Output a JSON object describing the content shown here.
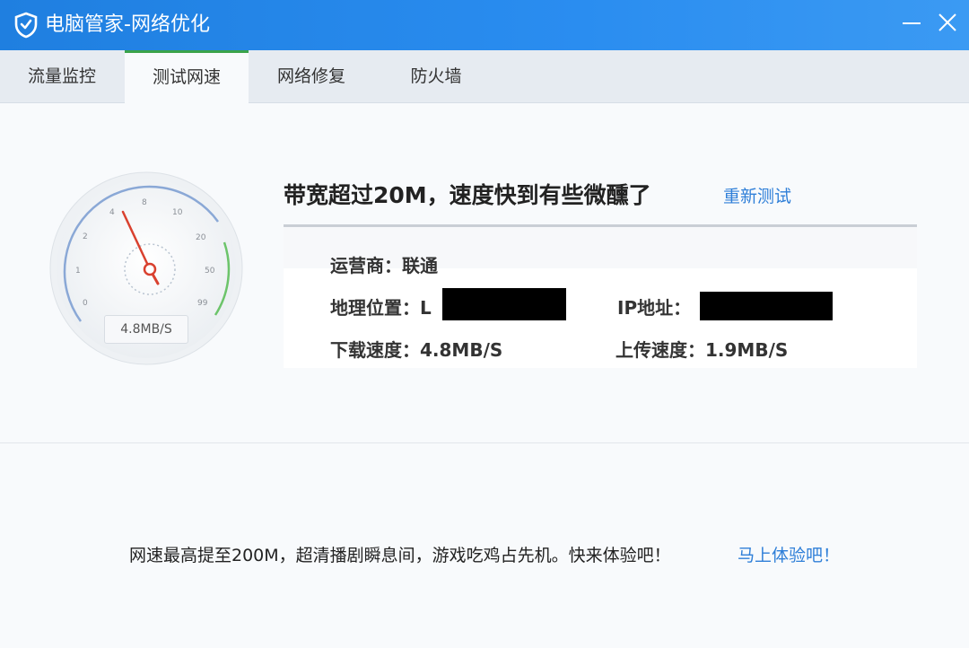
{
  "window": {
    "title": "电脑管家-网络优化"
  },
  "tabs": [
    {
      "label": "流量监控"
    },
    {
      "label": "测试网速",
      "active": true
    },
    {
      "label": "网络修复"
    },
    {
      "label": "防火墙"
    }
  ],
  "gauge": {
    "ticks": [
      "0",
      "1",
      "2",
      "4",
      "8",
      "10",
      "20",
      "50",
      "99"
    ],
    "readout": "4.8MB/S"
  },
  "result": {
    "headline": "带宽超过20M，速度快到有些微醺了",
    "retest_label": "重新测试"
  },
  "info": {
    "isp_label": "运营商：",
    "isp_value": "联通",
    "location_label": "地理位置：",
    "location_partial": "L",
    "ip_label": "IP地址：",
    "download_label": "下载速度：",
    "download_value": "4.8MB/S",
    "upload_label": "上传速度：",
    "upload_value": "1.9MB/S"
  },
  "promo": {
    "text": "网速最高提至200M，超清播剧瞬息间，游戏吃鸡占先机。快来体验吧！",
    "link": "马上体验吧！"
  },
  "colors": {
    "titlebar": "#1f7fe0",
    "tab_active_accent": "#3aa34a",
    "link": "#2f7fd8",
    "needle": "#d9412f"
  }
}
